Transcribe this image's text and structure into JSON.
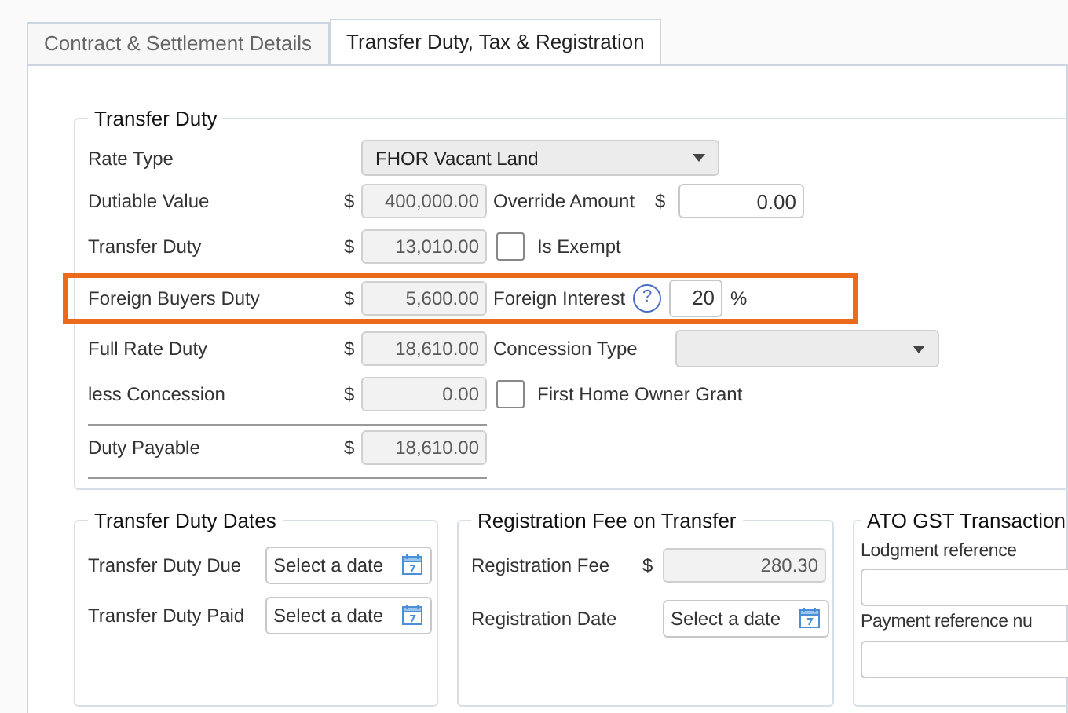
{
  "tabs": [
    {
      "label": "Contract & Settlement Details",
      "selected": false
    },
    {
      "label": "Transfer Duty, Tax & Registration",
      "selected": true
    }
  ],
  "transfer_duty": {
    "title": "Transfer Duty",
    "rate_type": {
      "label": "Rate Type",
      "value": "FHOR Vacant Land"
    },
    "rows": [
      {
        "label": "Dutiable Value",
        "currency": "$",
        "value": "400,000.00",
        "highlighted": false,
        "total": false,
        "extra": {
          "kind": "amount",
          "label": "Override Amount",
          "currency": "$",
          "value": "0.00"
        }
      },
      {
        "label": "Transfer Duty",
        "currency": "$",
        "value": "13,010.00",
        "highlighted": false,
        "total": false,
        "extra": {
          "kind": "checkbox",
          "label": "Is Exempt",
          "checked": false
        }
      },
      {
        "label": "Foreign Buyers Duty",
        "currency": "$",
        "value": "5,600.00",
        "highlighted": true,
        "total": false,
        "extra": {
          "kind": "percent",
          "label": "Foreign Interest",
          "help": "?",
          "value": "20",
          "unit": "%"
        }
      },
      {
        "label": "Full Rate Duty",
        "currency": "$",
        "value": "18,610.00",
        "highlighted": false,
        "total": false,
        "extra": {
          "kind": "dropdown",
          "label": "Concession Type"
        }
      },
      {
        "label": "less Concession",
        "currency": "$",
        "value": "0.00",
        "highlighted": false,
        "total": false,
        "extra": {
          "kind": "checkbox",
          "label": "First Home Owner Grant",
          "checked": false
        }
      },
      {
        "label": "Duty Payable",
        "currency": "$",
        "value": "18,610.00",
        "highlighted": false,
        "total": true
      }
    ]
  },
  "transfer_duty_dates": {
    "title": "Transfer Duty Dates",
    "fields": [
      {
        "label": "Transfer Duty Due",
        "placeholder": "Select a date"
      },
      {
        "label": "Transfer Duty Paid",
        "placeholder": "Select a date"
      }
    ]
  },
  "registration_fee": {
    "title": "Registration Fee on Transfer",
    "fee": {
      "label": "Registration Fee",
      "currency": "$",
      "value": "280.30"
    },
    "date": {
      "label": "Registration Date",
      "placeholder": "Select a date"
    }
  },
  "ato_gst": {
    "title": "ATO GST Transaction",
    "fields": [
      {
        "label": "Lodgment reference"
      },
      {
        "label": "Payment reference nu"
      }
    ]
  }
}
